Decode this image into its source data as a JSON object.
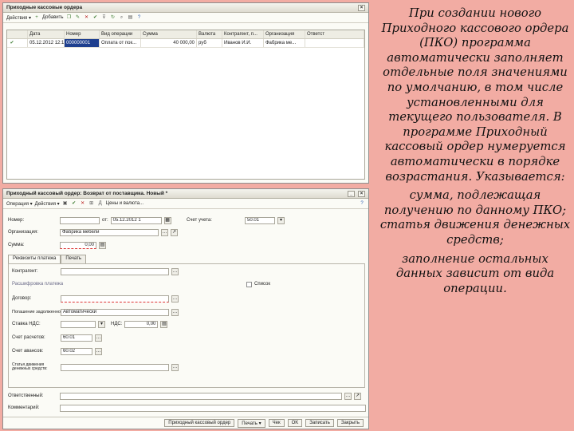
{
  "list_window": {
    "title": "Приходные кассовые ордера",
    "toolbar": {
      "actions": "Действия ▾",
      "add": "Добавить"
    },
    "columns": [
      "Дата",
      "Номер",
      "Вид операции",
      "Сумма",
      "Валюта",
      "Контрагент, п...",
      "Организация",
      "Ответст"
    ],
    "rows": [
      [
        "05.12.2012 12:12:19",
        "000000001",
        "Оплата от пок...",
        "40 000,00",
        "руб",
        "Иванов И.И.",
        "Фабрика ме...",
        ""
      ]
    ]
  },
  "form_window": {
    "title": "Приходный кассовый ордер: Возврат от поставщика. Новый *",
    "toolbar": {
      "operation": "Операция ▾",
      "actions": "Действия ▾",
      "price_label": "Цены и валюта..."
    },
    "fields": {
      "number_label": "Номер:",
      "from_label": "от:",
      "date_value": "05.12.2012 1",
      "account_label": "Счет учета:",
      "account_value": "50.01",
      "org_label": "Организация:",
      "org_value": "Фабрика мебели",
      "sum_label": "Сумма:",
      "sum_value": "0,00"
    },
    "tabs": [
      "Реквизиты платежа",
      "Печать"
    ],
    "details": {
      "counterparty_label": "Контрагент:",
      "settlement_group": "Расшифровка платежа",
      "list_label": "Список",
      "contract_label": "Договор:",
      "advance_label": "Погашение задолженности:",
      "advance_value": "Автоматически",
      "vat_label": "Ставка НДС:",
      "vat_sum_label": "НДС:",
      "vat_sum_value": "0,00",
      "settlement_account_label": "Счет расчетов:",
      "settlement_account_value": "60.01",
      "advance_account_label": "Счет авансов:",
      "advance_account_value": "60.02",
      "cashflow_label": "Статья движения денежных средств:"
    },
    "responsible_label": "Ответственный:",
    "comment_label": "Комментарий:",
    "bottom_buttons": [
      "Приходный кассовый ордер",
      "Печать ▾",
      "Чек",
      "OK",
      "Записать",
      "Закрыть"
    ]
  },
  "text_panel": {
    "intro": "При создании нового Приходного кассового ордера (ПКО) программа автоматически заполняет отдельные поля значениями по умолчанию, в том числе установленными для текущего пользователя. В программе Приходный кассовый ордер нумеруется автоматически в порядке возрастания. Указывается:",
    "item1": "сумма, подлежащая получению по данному ПКО;",
    "item2": "статья движения денежных средств;",
    "item3": "заполнение остальных данных зависит от вида операции."
  },
  "colors": {
    "background": "#f2aca3",
    "selection": "#1e3f8f"
  }
}
